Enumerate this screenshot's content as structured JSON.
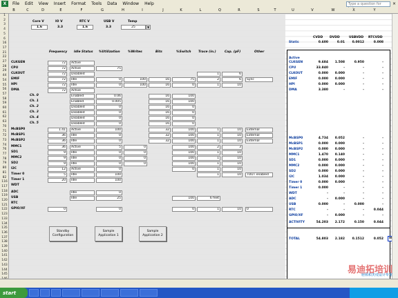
{
  "menubar": {
    "items": [
      "File",
      "Edit",
      "View",
      "Insert",
      "Format",
      "Tools",
      "Data",
      "Window",
      "Help"
    ],
    "ask_placeholder": "Type a question for help"
  },
  "columns": [
    "B",
    "C",
    "D",
    "E",
    "F",
    "G",
    "H",
    "I",
    "J",
    "K",
    "L",
    "Q",
    "R",
    "S",
    "T",
    "U",
    "V",
    "W",
    "X",
    "Y"
  ],
  "rows": [
    "1",
    "2",
    "3",
    "4",
    "5",
    "6",
    "16",
    "17",
    "21",
    "22",
    "27",
    "28",
    "29",
    "44",
    "54",
    "55",
    "56",
    "57",
    "58",
    "59",
    "60",
    "61",
    "62",
    "63",
    "70",
    "71",
    "72",
    "73",
    "74",
    "76",
    "77",
    "78",
    "79",
    "80",
    "81",
    "82",
    "116",
    "117",
    "118",
    "119",
    "120",
    "121",
    "122",
    "123",
    "133",
    "134",
    "135",
    "136",
    "137",
    "138",
    "139",
    "140",
    "141",
    "142",
    "143",
    "144",
    "145",
    "146",
    "147"
  ],
  "header_inputs": {
    "core_label": "Core V",
    "core_val": "1.6",
    "io_label": "IO V",
    "io_val": "3.3",
    "rtc_label": "RTC V",
    "rtc_val": "1.6",
    "usb_label": "USB V",
    "usb_val": "3.3",
    "temp_label": "Temp",
    "temp_val": "25"
  },
  "table_headers": {
    "freq": "Frequency",
    "idle": "Idle Status",
    "util": "%Utilization",
    "writes": "%Writes",
    "bits": "Bits",
    "switch": "%Switch",
    "trace": "Trace (in.)",
    "cap": "Cap. (pF)",
    "other": "Other"
  },
  "modules": [
    {
      "name": "CLKGEN",
      "freq": "72",
      "idle": "Active",
      "util": "",
      "writes": "",
      "bits": "",
      "sw": "",
      "trace": "",
      "cap": "",
      "other": ""
    },
    {
      "name": "CPU",
      "freq": "72",
      "idle": "Active",
      "util": "75",
      "writes": "",
      "bits": "",
      "sw": "",
      "trace": "",
      "cap": "",
      "other": ""
    },
    {
      "name": "CLKOUT",
      "freq": "72",
      "idle": "Disabled",
      "util": "",
      "writes": "",
      "bits": "",
      "sw": "",
      "trace": "1",
      "cap": "6",
      "other": ""
    },
    {
      "name": "EMIF",
      "freq": "72",
      "idle": "Idle",
      "util": "0",
      "writes": "100",
      "bits": "16",
      "sw": "75",
      "trace": "2",
      "cap": "6",
      "other": "Sync"
    },
    {
      "name": "HPI",
      "freq": "72",
      "idle": "Idle",
      "util": "0",
      "writes": "100",
      "bits": "16",
      "sw": "0",
      "trace": "1",
      "cap": "10",
      "other": ""
    },
    {
      "name": "DMA",
      "freq": "72",
      "idle": "Active",
      "util": "",
      "writes": "",
      "bits": "",
      "sw": "",
      "trace": "",
      "cap": "",
      "other": ""
    },
    {
      "name": "Ch. 0",
      "freq": "",
      "idle": "Enabled",
      "util": "0.06",
      "writes": "",
      "bits": "16",
      "sw": "100",
      "trace": "",
      "cap": "",
      "other": ""
    },
    {
      "name": "Ch. 1",
      "freq": "",
      "idle": "Enabled",
      "util": "0.005",
      "writes": "",
      "bits": "16",
      "sw": "100",
      "trace": "",
      "cap": "",
      "other": ""
    },
    {
      "name": "Ch. 2",
      "freq": "",
      "idle": "Disabled",
      "util": "0",
      "writes": "",
      "bits": "16",
      "sw": "0",
      "trace": "",
      "cap": "",
      "other": ""
    },
    {
      "name": "Ch. 3",
      "freq": "",
      "idle": "Disabled",
      "util": "0",
      "writes": "",
      "bits": "16",
      "sw": "0",
      "trace": "",
      "cap": "",
      "other": ""
    },
    {
      "name": "Ch. 4",
      "freq": "",
      "idle": "Disabled",
      "util": "0",
      "writes": "",
      "bits": "16",
      "sw": "0",
      "trace": "",
      "cap": "",
      "other": ""
    },
    {
      "name": "Ch. 5",
      "freq": "",
      "idle": "Disabled",
      "util": "0",
      "writes": "",
      "bits": "16",
      "sw": "0",
      "trace": "",
      "cap": "",
      "other": ""
    },
    {
      "name": "McBSP0",
      "freq": "1.41",
      "idle": "Active",
      "util": "100",
      "writes": "",
      "bits": "32",
      "sw": "100",
      "trace": "1",
      "cap": "10",
      "other": "External"
    },
    {
      "name": "McBSP1",
      "freq": "36",
      "idle": "Idle",
      "util": "0",
      "writes": "",
      "bits": "32",
      "sw": "100",
      "trace": "1",
      "cap": "10",
      "other": "External"
    },
    {
      "name": "McBSP2",
      "freq": "36",
      "idle": "Idle",
      "util": "0",
      "writes": "",
      "bits": "32",
      "sw": "100",
      "trace": "1",
      "cap": "10",
      "other": "External"
    },
    {
      "name": "MMC1",
      "freq": "36",
      "idle": "Active",
      "util": "5",
      "writes": "0",
      "bits": "",
      "sw": "100",
      "trace": "2",
      "cap": "3",
      "other": ""
    },
    {
      "name": "SD1",
      "freq": "9",
      "idle": "Idle",
      "util": "0",
      "writes": "0",
      "bits": "",
      "sw": "100",
      "trace": "1",
      "cap": "10",
      "other": ""
    },
    {
      "name": "MMC2",
      "freq": "9",
      "idle": "Idle",
      "util": "0",
      "writes": "0",
      "bits": "",
      "sw": "100",
      "trace": "1",
      "cap": "10",
      "other": ""
    },
    {
      "name": "SD2",
      "freq": "9",
      "idle": "Idle",
      "util": "0",
      "writes": "0",
      "bits": "",
      "sw": "100",
      "trace": "1",
      "cap": "10",
      "other": ""
    },
    {
      "name": "I2C",
      "freq": "12",
      "idle": "Active",
      "util": "0",
      "writes": "",
      "bits": "",
      "sw": "0",
      "trace": "1",
      "cap": "10",
      "other": ""
    },
    {
      "name": "Timer 0",
      "freq": "5",
      "idle": "Idle",
      "util": "100",
      "writes": "",
      "bits": "",
      "sw": "",
      "trace": "1",
      "cap": "10",
      "other": "TOUT enabled"
    },
    {
      "name": "Timer 1",
      "freq": "20",
      "idle": "Idle",
      "util": "100",
      "writes": "",
      "bits": "",
      "sw": "",
      "trace": "",
      "cap": "",
      "other": ""
    },
    {
      "name": "WDT",
      "freq": "",
      "idle": "",
      "util": "",
      "writes": "",
      "bits": "",
      "sw": "",
      "trace": "",
      "cap": "",
      "other": ""
    },
    {
      "name": "ADC",
      "freq": "",
      "idle": "Idle",
      "util": "0",
      "writes": "",
      "bits": "",
      "sw": "",
      "trace": "",
      "cap": "",
      "other": ""
    },
    {
      "name": "USB",
      "freq": "",
      "idle": "Idle",
      "util": "25",
      "writes": "",
      "bits": "",
      "sw": "100",
      "trace": "6 feet",
      "cap": "",
      "other": ""
    },
    {
      "name": "RTC",
      "freq": "",
      "idle": "",
      "util": "",
      "writes": "",
      "bits": "",
      "sw": "",
      "trace": "",
      "cap": "",
      "other": ""
    },
    {
      "name": "GPIO/XF",
      "freq": "0",
      "idle": "",
      "util": "0",
      "writes": "",
      "bits": "",
      "sw": "0",
      "trace": "1",
      "cap": "10",
      "other": "0"
    }
  ],
  "panel": {
    "headers": [
      "CVDD",
      "DVDD",
      "USBVDD",
      "RTCVDD"
    ],
    "static": {
      "label": "Static",
      "vals": [
        "0.600",
        "0.01",
        "0.0012",
        "0.008"
      ]
    },
    "active_label": "Active",
    "rows": [
      {
        "name": "CLKGEN",
        "vals": [
          "9.684",
          "1.508",
          "0.950",
          "-"
        ]
      },
      {
        "name": "CPU",
        "vals": [
          "33.840",
          "-",
          "-",
          "-"
        ]
      },
      {
        "name": "CLKOUT",
        "vals": [
          "0.000",
          "0.000",
          "-",
          "-"
        ]
      },
      {
        "name": "EMIF",
        "vals": [
          "0.000",
          "0.000",
          "-",
          "-"
        ]
      },
      {
        "name": "HPI",
        "vals": [
          "0.000",
          "0.000",
          "-",
          "-"
        ]
      },
      {
        "name": "DMA",
        "vals": [
          "3.380",
          "-",
          "-",
          "-"
        ]
      },
      {
        "name": "McBSP0",
        "vals": [
          "4.734",
          "0.052",
          "-",
          "-"
        ]
      },
      {
        "name": "McBSP1",
        "vals": [
          "0.000",
          "0.000",
          "-",
          "-"
        ]
      },
      {
        "name": "McBSP2",
        "vals": [
          "0.000",
          "0.000",
          "-",
          "-"
        ]
      },
      {
        "name": "MMC1",
        "vals": [
          "1.470",
          "0.140",
          "-",
          "-"
        ]
      },
      {
        "name": "SD1",
        "vals": [
          "0.000",
          "0.000",
          "-",
          "-"
        ]
      },
      {
        "name": "MMC2",
        "vals": [
          "0.000",
          "0.000",
          "-",
          "-"
        ]
      },
      {
        "name": "SD2",
        "vals": [
          "0.000",
          "0.000",
          "-",
          "-"
        ]
      },
      {
        "name": "I2C",
        "vals": [
          "1.034",
          "0.000",
          "-",
          "-"
        ]
      },
      {
        "name": "Timer 0",
        "vals": [
          "0.000",
          "0.000",
          "-",
          "-"
        ]
      },
      {
        "name": "Timer 1",
        "vals": [
          "0.000",
          "-",
          "-",
          "-"
        ]
      },
      {
        "name": "WDT",
        "vals": [
          "-",
          "-",
          "-",
          "-"
        ]
      },
      {
        "name": "ADC",
        "vals": [
          "-",
          "0.000",
          "-",
          "-"
        ]
      },
      {
        "name": "USB",
        "vals": [
          "0.000",
          "-",
          "0.000",
          "-"
        ]
      },
      {
        "name": "RTC",
        "vals": [
          "-",
          "-",
          "-",
          "0.044"
        ]
      },
      {
        "name": "GPIO/XF",
        "vals": [
          "-",
          "0.000",
          "-",
          "-"
        ]
      }
    ],
    "activity": {
      "label": "ACTIVITY",
      "vals": [
        "54.203",
        "2.172",
        "0.150",
        "0.044"
      ]
    },
    "total": {
      "label": "TOTAL",
      "vals": [
        "54.803",
        "2.182",
        "0.1512",
        "0.052"
      ],
      "unit": "mA"
    }
  },
  "buttons": {
    "standby": "Standby Configuration",
    "sample1": "Sample Application 1",
    "sample2": "Sample Application 2"
  },
  "taskbar": {
    "start": "start"
  },
  "watermark": {
    "cn": "易迪拓培训",
    "sub": "射频和天线设计专家"
  }
}
